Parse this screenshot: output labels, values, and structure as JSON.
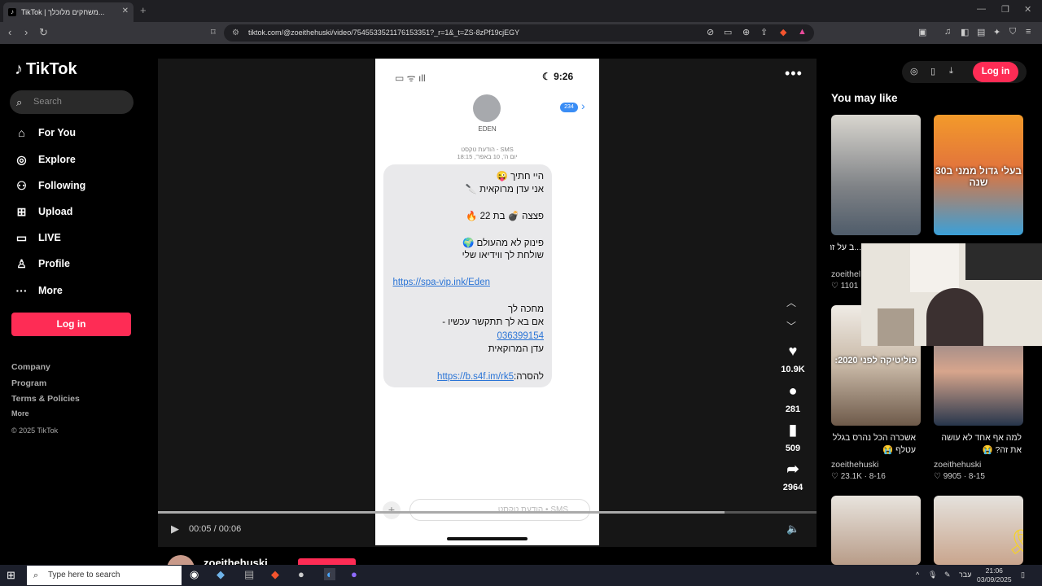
{
  "browser": {
    "tab_title": "TikTok | משחקים מלוכלך...",
    "url": "tiktok.com/@zoeithehuski/video/7545533521176153351?_r=1&_t=ZS-8zPf19cjEGY"
  },
  "sidebar": {
    "brand": "TikTok",
    "search_placeholder": "Search",
    "items": [
      {
        "label": "For You",
        "icon": "home-icon"
      },
      {
        "label": "Explore",
        "icon": "compass-icon"
      },
      {
        "label": "Following",
        "icon": "following-icon"
      },
      {
        "label": "Upload",
        "icon": "upload-icon"
      },
      {
        "label": "LIVE",
        "icon": "live-icon"
      },
      {
        "label": "Profile",
        "icon": "profile-icon"
      },
      {
        "label": "More",
        "icon": "more-icon"
      }
    ],
    "login_label": "Log in",
    "footer": {
      "company": "Company",
      "program": "Program",
      "terms": "Terms & Policies",
      "more": "More",
      "copyright": "© 2025 TikTok"
    }
  },
  "phone": {
    "time": "9:26",
    "contact": "EDEN",
    "badge": "234",
    "sms_header_line1": "הודעת טקסט - SMS",
    "sms_header_line2": "יום ה', 10 באפר', 18:15",
    "message_lines": [
      "היי חתיך 😜",
      "אני עדן מרוקאית 🔪",
      "פצצה 💣 בת 22 🔥",
      "פינוק לא מהעולם 🌍",
      "שולחת לך ווידיאו שלי",
      "https://spa-vip.ink/Eden",
      "מחכה לך",
      "אם בא לך תתקשר עכשיו -",
      "036399154",
      "עדן המרוקאית",
      "להסרה:",
      "https://b.s4f.im/rk5"
    ],
    "input_placeholder": "הודעת טקסט • SMS"
  },
  "player": {
    "time": "00:05 / 00:06",
    "progress_fraction": 0.86
  },
  "actions": {
    "likes": "10.9K",
    "comments": "281",
    "saves": "509",
    "shares": "2964"
  },
  "author": {
    "handle": "zoeithehuski"
  },
  "right_rail": {
    "login_label": "Log in",
    "heading": "You may like",
    "cards": [
      {
        "overlay": "",
        "caption": "...ב על זה לפניי",
        "user": "zoeithel",
        "likes": "1101",
        "date": ""
      },
      {
        "overlay": "בעלי גדול ממני ב30 שנה",
        "caption": "",
        "user": "",
        "likes": "",
        "date": ""
      },
      {
        "overlay": "פוליטיקה לפני 2020:",
        "caption": "אשכרה הכל נהרס בגלל עטלף 😭",
        "user": "zoeithehuski",
        "likes": "23.1K",
        "date": "8-16"
      },
      {
        "overlay": "",
        "caption": "למה אף אחד לא עושה את זה? 😭",
        "user": "zoeithehuski",
        "likes": "9905",
        "date": "8-15"
      }
    ]
  },
  "taskbar": {
    "search_placeholder": "Type here to search",
    "lang": "עבר",
    "time": "21:06",
    "date": "03/09/2025"
  }
}
